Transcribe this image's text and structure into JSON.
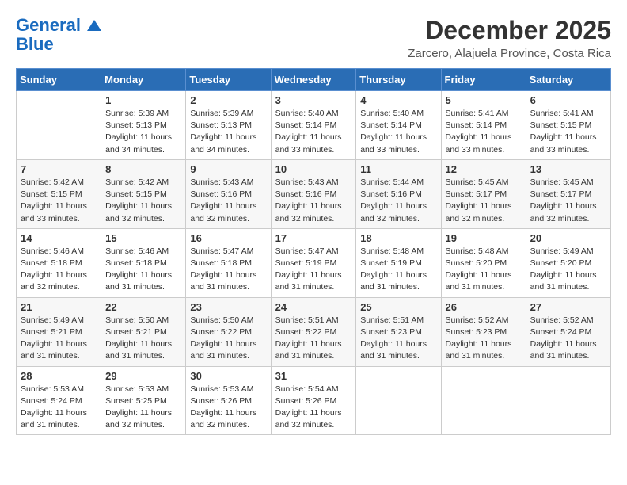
{
  "header": {
    "logo_line1": "General",
    "logo_line2": "Blue",
    "month_title": "December 2025",
    "location": "Zarcero, Alajuela Province, Costa Rica"
  },
  "weekdays": [
    "Sunday",
    "Monday",
    "Tuesday",
    "Wednesday",
    "Thursday",
    "Friday",
    "Saturday"
  ],
  "weeks": [
    [
      {
        "day": "",
        "info": ""
      },
      {
        "day": "1",
        "info": "Sunrise: 5:39 AM\nSunset: 5:13 PM\nDaylight: 11 hours\nand 34 minutes."
      },
      {
        "day": "2",
        "info": "Sunrise: 5:39 AM\nSunset: 5:13 PM\nDaylight: 11 hours\nand 34 minutes."
      },
      {
        "day": "3",
        "info": "Sunrise: 5:40 AM\nSunset: 5:14 PM\nDaylight: 11 hours\nand 33 minutes."
      },
      {
        "day": "4",
        "info": "Sunrise: 5:40 AM\nSunset: 5:14 PM\nDaylight: 11 hours\nand 33 minutes."
      },
      {
        "day": "5",
        "info": "Sunrise: 5:41 AM\nSunset: 5:14 PM\nDaylight: 11 hours\nand 33 minutes."
      },
      {
        "day": "6",
        "info": "Sunrise: 5:41 AM\nSunset: 5:15 PM\nDaylight: 11 hours\nand 33 minutes."
      }
    ],
    [
      {
        "day": "7",
        "info": "Sunrise: 5:42 AM\nSunset: 5:15 PM\nDaylight: 11 hours\nand 33 minutes."
      },
      {
        "day": "8",
        "info": "Sunrise: 5:42 AM\nSunset: 5:15 PM\nDaylight: 11 hours\nand 32 minutes."
      },
      {
        "day": "9",
        "info": "Sunrise: 5:43 AM\nSunset: 5:16 PM\nDaylight: 11 hours\nand 32 minutes."
      },
      {
        "day": "10",
        "info": "Sunrise: 5:43 AM\nSunset: 5:16 PM\nDaylight: 11 hours\nand 32 minutes."
      },
      {
        "day": "11",
        "info": "Sunrise: 5:44 AM\nSunset: 5:16 PM\nDaylight: 11 hours\nand 32 minutes."
      },
      {
        "day": "12",
        "info": "Sunrise: 5:45 AM\nSunset: 5:17 PM\nDaylight: 11 hours\nand 32 minutes."
      },
      {
        "day": "13",
        "info": "Sunrise: 5:45 AM\nSunset: 5:17 PM\nDaylight: 11 hours\nand 32 minutes."
      }
    ],
    [
      {
        "day": "14",
        "info": "Sunrise: 5:46 AM\nSunset: 5:18 PM\nDaylight: 11 hours\nand 32 minutes."
      },
      {
        "day": "15",
        "info": "Sunrise: 5:46 AM\nSunset: 5:18 PM\nDaylight: 11 hours\nand 31 minutes."
      },
      {
        "day": "16",
        "info": "Sunrise: 5:47 AM\nSunset: 5:18 PM\nDaylight: 11 hours\nand 31 minutes."
      },
      {
        "day": "17",
        "info": "Sunrise: 5:47 AM\nSunset: 5:19 PM\nDaylight: 11 hours\nand 31 minutes."
      },
      {
        "day": "18",
        "info": "Sunrise: 5:48 AM\nSunset: 5:19 PM\nDaylight: 11 hours\nand 31 minutes."
      },
      {
        "day": "19",
        "info": "Sunrise: 5:48 AM\nSunset: 5:20 PM\nDaylight: 11 hours\nand 31 minutes."
      },
      {
        "day": "20",
        "info": "Sunrise: 5:49 AM\nSunset: 5:20 PM\nDaylight: 11 hours\nand 31 minutes."
      }
    ],
    [
      {
        "day": "21",
        "info": "Sunrise: 5:49 AM\nSunset: 5:21 PM\nDaylight: 11 hours\nand 31 minutes."
      },
      {
        "day": "22",
        "info": "Sunrise: 5:50 AM\nSunset: 5:21 PM\nDaylight: 11 hours\nand 31 minutes."
      },
      {
        "day": "23",
        "info": "Sunrise: 5:50 AM\nSunset: 5:22 PM\nDaylight: 11 hours\nand 31 minutes."
      },
      {
        "day": "24",
        "info": "Sunrise: 5:51 AM\nSunset: 5:22 PM\nDaylight: 11 hours\nand 31 minutes."
      },
      {
        "day": "25",
        "info": "Sunrise: 5:51 AM\nSunset: 5:23 PM\nDaylight: 11 hours\nand 31 minutes."
      },
      {
        "day": "26",
        "info": "Sunrise: 5:52 AM\nSunset: 5:23 PM\nDaylight: 11 hours\nand 31 minutes."
      },
      {
        "day": "27",
        "info": "Sunrise: 5:52 AM\nSunset: 5:24 PM\nDaylight: 11 hours\nand 31 minutes."
      }
    ],
    [
      {
        "day": "28",
        "info": "Sunrise: 5:53 AM\nSunset: 5:24 PM\nDaylight: 11 hours\nand 31 minutes."
      },
      {
        "day": "29",
        "info": "Sunrise: 5:53 AM\nSunset: 5:25 PM\nDaylight: 11 hours\nand 32 minutes."
      },
      {
        "day": "30",
        "info": "Sunrise: 5:53 AM\nSunset: 5:26 PM\nDaylight: 11 hours\nand 32 minutes."
      },
      {
        "day": "31",
        "info": "Sunrise: 5:54 AM\nSunset: 5:26 PM\nDaylight: 11 hours\nand 32 minutes."
      },
      {
        "day": "",
        "info": ""
      },
      {
        "day": "",
        "info": ""
      },
      {
        "day": "",
        "info": ""
      }
    ]
  ]
}
